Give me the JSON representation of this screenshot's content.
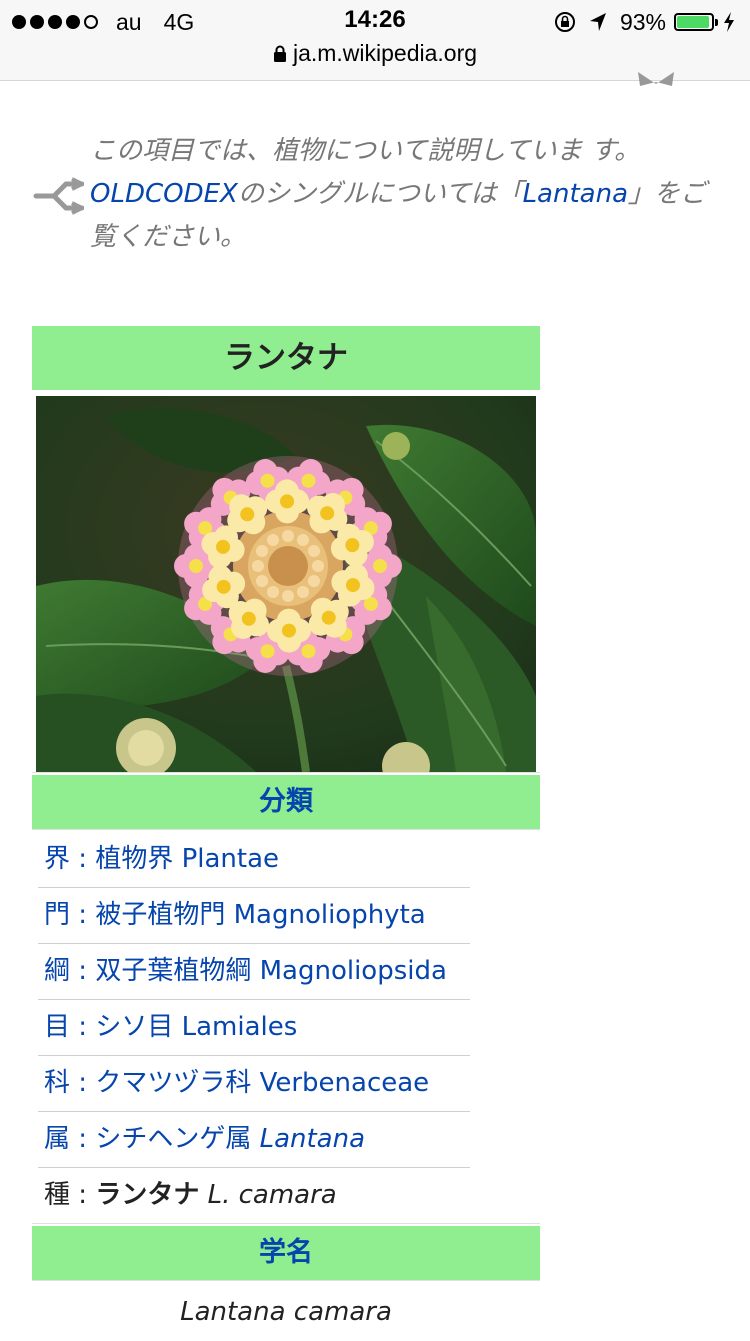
{
  "statusbar": {
    "carrier": "au",
    "network": "4G",
    "time": "14:26",
    "battery_percent": "93%",
    "battery_level": 0.93,
    "signal_bars_filled": 4,
    "signal_bars_total": 5,
    "url": "ja.m.wikipedia.org"
  },
  "hatnote": {
    "prefix": "この項目では、植物について説明していま す。",
    "link1": "OLDCODEX",
    "middle": "のシングルについては「",
    "link2": "Lantana",
    "suffix": "」をご覧ください。"
  },
  "infobox": {
    "title": "ランタナ",
    "image_subject": "lantana-flower-photo",
    "classification_heading": "分類",
    "ranks": [
      {
        "rank": "界",
        "name": "植物界",
        "latin": "Plantae"
      },
      {
        "rank": "門",
        "name": "被子植物門",
        "latin": "Magnoliophyta"
      },
      {
        "rank": "綱",
        "name": "双子葉植物綱",
        "latin": "Magnoliopsida"
      },
      {
        "rank": "目",
        "name": "シソ目",
        "latin": "Lamiales"
      },
      {
        "rank": "科",
        "name": "クマツヅラ科",
        "latin": "Verbenaceae"
      },
      {
        "rank": "属",
        "name": "シチヘンゲ属",
        "latin": "Lantana"
      },
      {
        "rank": "種",
        "name": "ランタナ",
        "latin": "L. camara"
      }
    ],
    "scientific_name_heading": "学名",
    "scientific_name": "Lantana camara"
  },
  "colors": {
    "infobox_header": "#90ee90",
    "link": "#0645ad",
    "battery": "#4cd964"
  }
}
